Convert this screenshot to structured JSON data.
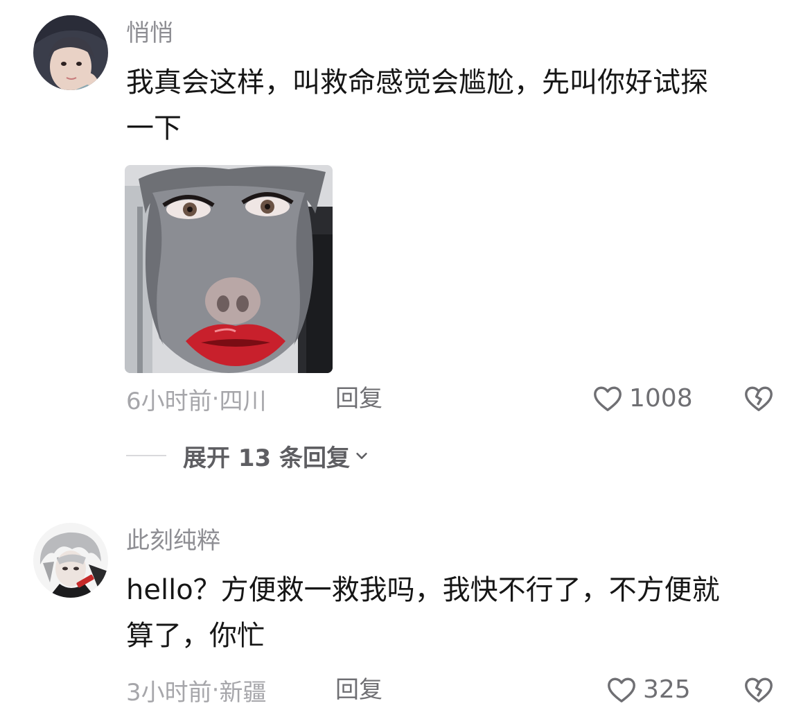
{
  "comments": [
    {
      "username": "悄悄",
      "text_lines": [
        "我真会这样，叫救命感觉会尴尬，先叫你好试探",
        "一下"
      ],
      "time": "6小时前",
      "location": "四川",
      "reply_label": "回复",
      "likes": "1008",
      "expand_label": "展开 13 条回复",
      "avatar_icon": "user-avatar-icon",
      "sticker_icon": "pig-face-sticker"
    },
    {
      "username": "此刻纯粹",
      "text_lines": [
        "hello？方便救一救我吗，我快不行了，不方便就",
        "算了，你忙"
      ],
      "time": "3小时前",
      "location": "新疆",
      "reply_label": "回复",
      "likes": "325",
      "avatar_icon": "user-avatar-icon"
    }
  ],
  "meta_separator": " · ",
  "colors": {
    "username": "#8e8e93",
    "text": "#161616",
    "meta": "#a6a6aa",
    "action": "#6f6f73",
    "lips": "#c8202c"
  },
  "icons": {
    "like": "heart-outline-icon",
    "dislike": "broken-heart-icon",
    "expand": "chevron-down-icon"
  }
}
